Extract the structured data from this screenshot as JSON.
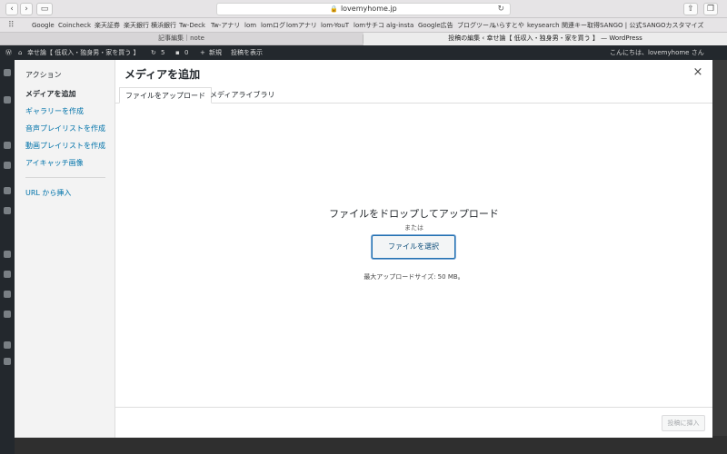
{
  "browser": {
    "url": "lovemyhome.jp",
    "bookmarks": [
      "Google",
      "Coincheck",
      "楽天証券",
      "楽天銀行",
      "横浜銀行",
      "Tw-Deck",
      "Tw-アナリ",
      "lom",
      "lomログ",
      "lomアナリ",
      "lom-YouT",
      "lomサチコ",
      "alg-insta",
      "Google広告",
      "ブログツール",
      "いらすとや",
      "keysearch",
      "関連キー取得",
      "SANGO | 公式",
      "SANGOカスタマイズ"
    ],
    "tabs": [
      {
        "label": "記事編集｜note",
        "active": false
      },
      {
        "label": "投稿の編集 ‹ 幸せ論【 低収入・独身男・家を買う 】 — WordPress",
        "active": true
      }
    ]
  },
  "admin_bar": {
    "site_name": "幸せ論【 低収入・独身男・家を買う 】",
    "updates": "5",
    "comments": "0",
    "new_label": "新規",
    "view_post": "投稿を表示",
    "greeting": "こんにちは、lovemyhome さん"
  },
  "modal": {
    "title": "メディアを追加",
    "close_glyph": "×",
    "menu_heading": "アクション",
    "menu_items": [
      {
        "label": "メディアを追加",
        "current": true
      },
      {
        "label": "ギャラリーを作成",
        "current": false
      },
      {
        "label": "音声プレイリストを作成",
        "current": false
      },
      {
        "label": "動画プレイリストを作成",
        "current": false
      },
      {
        "label": "アイキャッチ画像",
        "current": false
      }
    ],
    "url_insert": "URL から挿入",
    "router_tabs": [
      {
        "label": "ファイルをアップロード",
        "active": true
      },
      {
        "label": "メディアライブラリ",
        "active": false
      }
    ],
    "drop_title": "ファイルをドロップしてアップロード",
    "or_text": "または",
    "select_button": "ファイルを選択",
    "max_size": "最大アップロードサイズ: 50 MB。",
    "insert_button": "投稿に挿入"
  }
}
